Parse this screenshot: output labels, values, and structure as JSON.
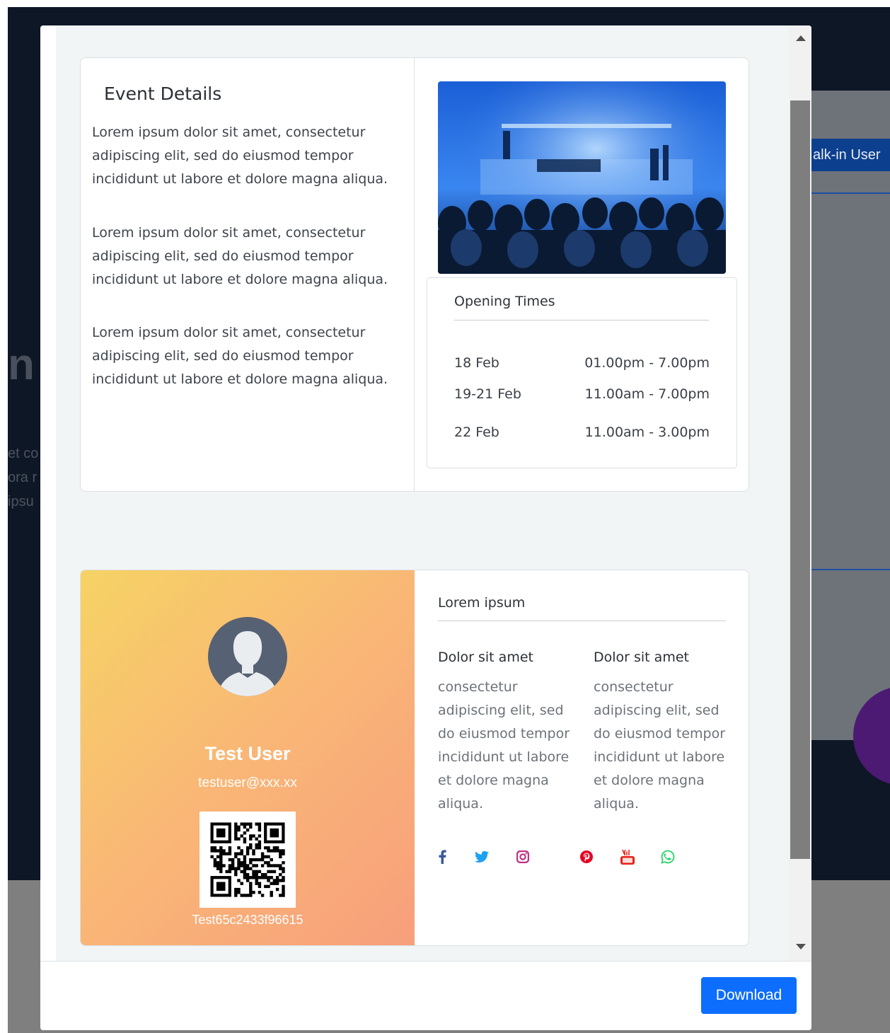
{
  "background": {
    "walkin_button_label": "alk-in User",
    "heading_fragment": "n h",
    "text_lines": [
      "et co",
      "ora r",
      "ipsu"
    ]
  },
  "event": {
    "title": "Event Details",
    "paragraphs": [
      "Lorem ipsum dolor sit amet, consectetur adipiscing elit, sed do eiusmod tempor incididunt ut labore et dolore magna aliqua.",
      "Lorem ipsum dolor sit amet, consectetur adipiscing elit, sed do eiusmod tempor incididunt ut labore et dolore magna aliqua.",
      "Lorem ipsum dolor sit amet, consectetur adipiscing elit, sed do eiusmod tempor incididunt ut labore et dolore magna aliqua."
    ]
  },
  "opening_times": {
    "title": "Opening Times",
    "rows": [
      {
        "date": "18 Feb",
        "time": "01.00pm - 7.00pm"
      },
      {
        "date": "19-21 Feb",
        "time": "11.00am - 7.00pm"
      },
      {
        "date": "22 Feb",
        "time": "11.00am - 3.00pm"
      }
    ]
  },
  "badge": {
    "name": "Test User",
    "email": "testuser@xxx.xx",
    "code": "Test65c2433f96615"
  },
  "info": {
    "title": "Lorem ipsum",
    "columns": [
      {
        "heading": "Dolor sit amet",
        "text": "consectetur adipiscing elit, sed do eiusmod tempor incididunt ut labore et dolore magna aliqua."
      },
      {
        "heading": "Dolor sit amet",
        "text": "consectetur adipiscing elit, sed do eiusmod tempor incididunt ut labore et dolore magna aliqua."
      }
    ]
  },
  "social_icons": [
    "facebook-icon",
    "twitter-icon",
    "instagram-icon",
    "pinterest-icon",
    "youtube-icon",
    "whatsapp-icon"
  ],
  "colors": {
    "primary_button": "#0d6efd",
    "facebook": "#3b5998",
    "twitter": "#1da1f2",
    "instagram": "#c13584",
    "pinterest": "#e60023",
    "youtube": "#e62117",
    "whatsapp": "#25d366"
  },
  "footer": {
    "download_label": "Download"
  }
}
